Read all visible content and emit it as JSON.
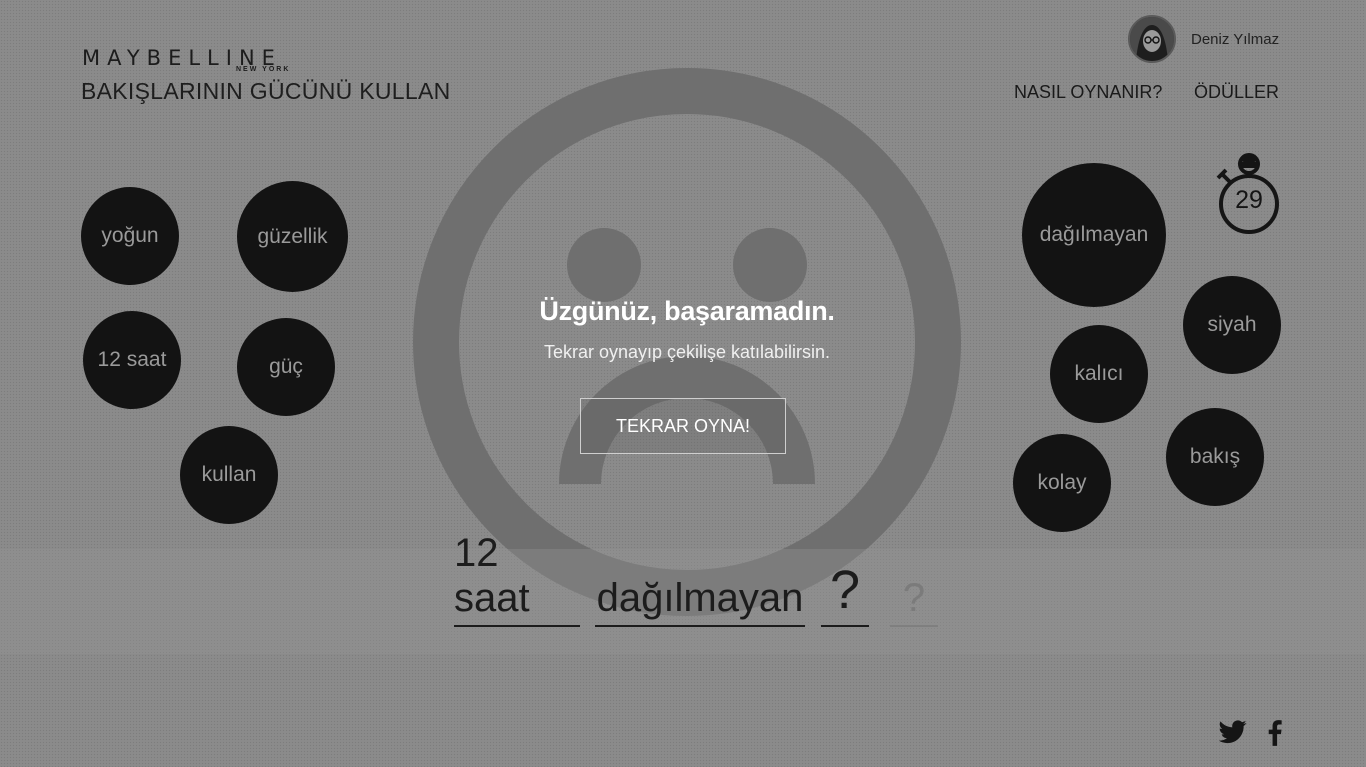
{
  "header": {
    "brand": "MAYBELLINE",
    "brand_sub": "NEW YORK",
    "tagline": "BAKIŞLARININ GÜCÜNÜ KULLAN"
  },
  "user": {
    "name": "Deniz Yılmaz",
    "avatar_icon": "user-avatar"
  },
  "nav": {
    "how_to_play": "NASIL OYNANIR?",
    "prizes": "ÖDÜLLER"
  },
  "timer": {
    "seconds": "29",
    "icon": "stopwatch-icon"
  },
  "left_words": [
    "yoğun",
    "güzellik",
    "12 saat",
    "güç",
    "kullan"
  ],
  "right_words": [
    "dağılmayan",
    "siyah",
    "kalıcı",
    "bakış",
    "kolay"
  ],
  "modal": {
    "title": "Üzgünüz, başaramadın.",
    "subtitle": "Tekrar oynayıp çekilişe katılabilirsin.",
    "replay_label": "TEKRAR OYNA!",
    "icon": "sad-face-icon"
  },
  "answer": {
    "slots": [
      "12 saat",
      "dağılmayan",
      "?",
      "?"
    ]
  },
  "social": {
    "twitter_icon": "twitter-icon",
    "facebook_icon": "facebook-icon"
  },
  "colors": {
    "background": "#8b8b8b",
    "bubble": "#131313",
    "bubble_text": "#9a9a9a",
    "modal_text": "#ffffff"
  }
}
